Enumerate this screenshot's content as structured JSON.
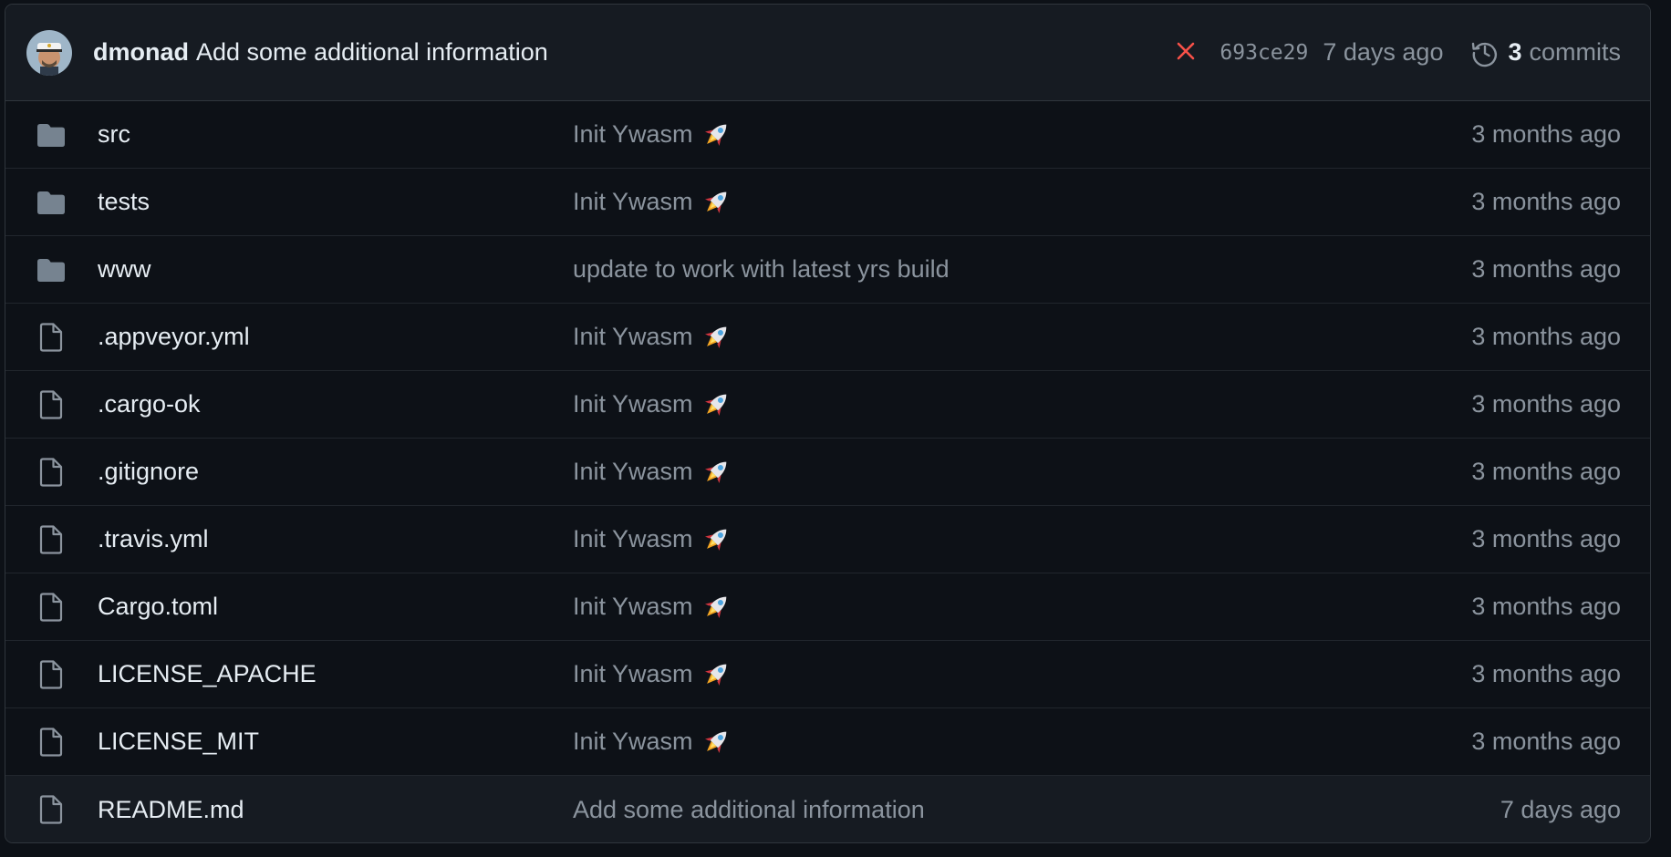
{
  "latest_commit": {
    "author": "dmonad",
    "message": "Add some additional information",
    "status_icon": "x-icon",
    "status_color": "#f85149",
    "sha": "693ce29",
    "time": "7 days ago",
    "commits_count": "3",
    "commits_label": "commits"
  },
  "files": [
    {
      "name": "src",
      "type": "directory",
      "icon": "folder-icon",
      "message": "Init Ywasm",
      "emoji": "rocket",
      "age": "3 months ago"
    },
    {
      "name": "tests",
      "type": "directory",
      "icon": "folder-icon",
      "message": "Init Ywasm",
      "emoji": "rocket",
      "age": "3 months ago"
    },
    {
      "name": "www",
      "type": "directory",
      "icon": "folder-icon",
      "message": "update to work with latest yrs build",
      "emoji": "",
      "age": "3 months ago"
    },
    {
      "name": ".appveyor.yml",
      "type": "file",
      "icon": "file-icon",
      "message": "Init Ywasm",
      "emoji": "rocket",
      "age": "3 months ago"
    },
    {
      "name": ".cargo-ok",
      "type": "file",
      "icon": "file-icon",
      "message": "Init Ywasm",
      "emoji": "rocket",
      "age": "3 months ago"
    },
    {
      "name": ".gitignore",
      "type": "file",
      "icon": "file-icon",
      "message": "Init Ywasm",
      "emoji": "rocket",
      "age": "3 months ago"
    },
    {
      "name": ".travis.yml",
      "type": "file",
      "icon": "file-icon",
      "message": "Init Ywasm",
      "emoji": "rocket",
      "age": "3 months ago"
    },
    {
      "name": "Cargo.toml",
      "type": "file",
      "icon": "file-icon",
      "message": "Init Ywasm",
      "emoji": "rocket",
      "age": "3 months ago"
    },
    {
      "name": "LICENSE_APACHE",
      "type": "file",
      "icon": "file-icon",
      "message": "Init Ywasm",
      "emoji": "rocket",
      "age": "3 months ago"
    },
    {
      "name": "LICENSE_MIT",
      "type": "file",
      "icon": "file-icon",
      "message": "Init Ywasm",
      "emoji": "rocket",
      "age": "3 months ago"
    },
    {
      "name": "README.md",
      "type": "file",
      "icon": "file-icon",
      "message": "Add some additional information",
      "emoji": "",
      "age": "7 days ago",
      "highlighted": true
    }
  ],
  "colors": {
    "background": "#0d1117",
    "header_background": "#161b22",
    "border": "#30363d",
    "text": "#e6edf3",
    "muted": "#8b949e",
    "folder_icon": "#768390"
  }
}
